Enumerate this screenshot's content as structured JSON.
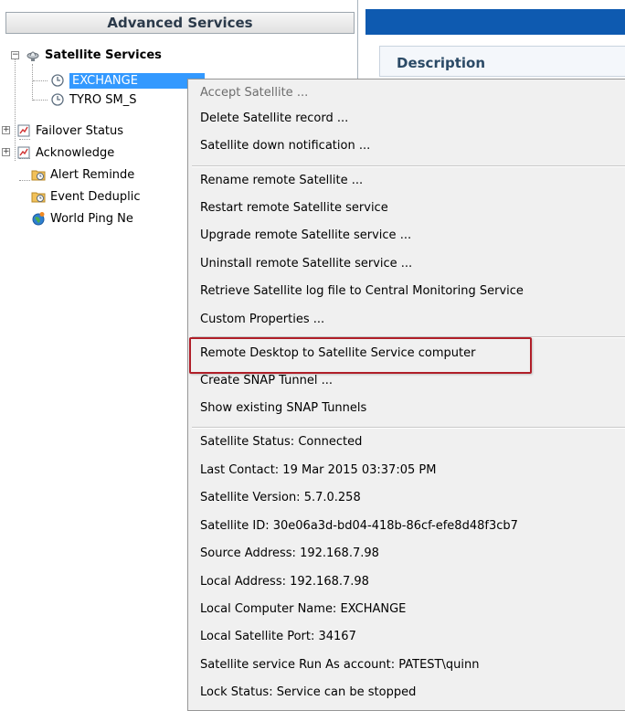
{
  "tree_panel": {
    "header": "Advanced Services",
    "items": [
      {
        "label": "Satellite Services",
        "icon": "satellite-icon"
      },
      {
        "label": "EXCHANGE - Local Satellite",
        "visible_label": "EXCHANGE",
        "icon": "clock-icon"
      },
      {
        "label": "TYRO SM_S",
        "visible_label": "TYRO SM_S",
        "icon": "clock-icon"
      },
      {
        "label": "Failover Status",
        "visible_label": "Failover Status",
        "icon": "report-icon"
      },
      {
        "label": "Acknowledge",
        "visible_label": "Acknowledge",
        "icon": "report-icon"
      },
      {
        "label": "Alert Reminde",
        "visible_label": "Alert Reminde",
        "icon": "folder-clock-icon"
      },
      {
        "label": "Event Deduplic",
        "visible_label": "Event Deduplic",
        "icon": "folder-clock-icon"
      },
      {
        "label": "World Ping Ne",
        "visible_label": "World Ping Ne",
        "icon": "globe-icon"
      }
    ]
  },
  "right_panel": {
    "description_title": "Description",
    "banner_color": "#0e5ab0"
  },
  "context_menu": {
    "group_1": [
      {
        "label": "Accept Satellite ...",
        "enabled": false
      },
      {
        "label": "Delete Satellite record ...",
        "enabled": true
      },
      {
        "label": "Satellite down notification ...",
        "enabled": true
      }
    ],
    "group_2": [
      {
        "label": "Rename remote Satellite ..."
      },
      {
        "label": "Restart remote Satellite service"
      },
      {
        "label": "Upgrade remote Satellite service ..."
      },
      {
        "label": "Uninstall remote Satellite service ..."
      },
      {
        "label": "Retrieve Satellite log file to Central Monitoring Service"
      },
      {
        "label": "Custom Properties ..."
      }
    ],
    "group_3": [
      {
        "label": "Remote Desktop to Satellite Service computer",
        "highlighted": true
      },
      {
        "label": "Create SNAP Tunnel ..."
      },
      {
        "label": "Show existing SNAP Tunnels"
      }
    ],
    "info": [
      {
        "label": "Satellite Status: Connected"
      },
      {
        "label": "Last Contact: 19 Mar 2015 03:37:05 PM"
      },
      {
        "label": "Satellite Version: 5.7.0.258"
      },
      {
        "label": "Satellite ID: 30e06a3d-bd04-418b-86cf-efe8d48f3cb7"
      },
      {
        "label": "Source Address: 192.168.7.98"
      },
      {
        "label": "Local Address: 192.168.7.98"
      },
      {
        "label": "Local Computer Name: EXCHANGE"
      },
      {
        "label": "Local Satellite Port: 34167"
      },
      {
        "label": "Satellite service Run As account: PATEST\\quinn"
      },
      {
        "label": "Lock Status: Service can be stopped"
      }
    ],
    "highlight_color": "#b01e28"
  }
}
